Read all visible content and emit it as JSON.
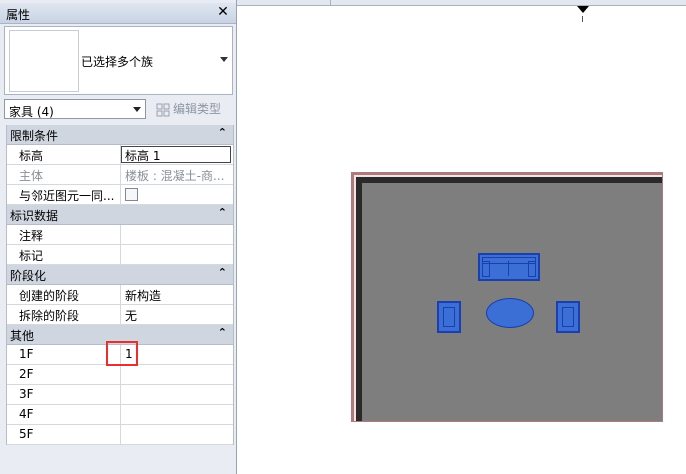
{
  "panel": {
    "title": "属性",
    "close_glyph": "✕",
    "type_selector": {
      "name": "已选择多个族"
    },
    "filter": {
      "label": "家具 (4)"
    },
    "edit_type": {
      "label": "编辑类型"
    }
  },
  "sections": [
    {
      "title": "限制条件",
      "collapse_glyph": "⌃",
      "rows": [
        {
          "key": "标高",
          "value": "标高 1",
          "state": "editing"
        },
        {
          "key": "主体",
          "value": "楼板 : 混凝土-商...",
          "state": "disabled"
        },
        {
          "key": "与邻近图元一同...",
          "value": "",
          "state": "checkbox"
        }
      ]
    },
    {
      "title": "标识数据",
      "collapse_glyph": "⌃",
      "rows": [
        {
          "key": "注释",
          "value": ""
        },
        {
          "key": "标记",
          "value": ""
        }
      ]
    },
    {
      "title": "阶段化",
      "collapse_glyph": "⌃",
      "rows": [
        {
          "key": "创建的阶段",
          "value": "新构造"
        },
        {
          "key": "拆除的阶段",
          "value": "无"
        }
      ]
    },
    {
      "title": "其他",
      "collapse_glyph": "⌃",
      "rows": [
        {
          "key": "1F",
          "value": "1"
        },
        {
          "key": "2F",
          "value": ""
        },
        {
          "key": "3F",
          "value": ""
        },
        {
          "key": "4F",
          "value": ""
        },
        {
          "key": "5F",
          "value": ""
        }
      ]
    }
  ],
  "colors": {
    "highlight": "#e8312e",
    "furniture": "#3b6fd6",
    "floor": "#7e7e7e",
    "panel_bg": "#e9ecf2"
  },
  "icons": [
    "close-icon",
    "dropdown-arrow-icon",
    "edit-type-icon",
    "collapse-icon",
    "view-marker-icon"
  ]
}
